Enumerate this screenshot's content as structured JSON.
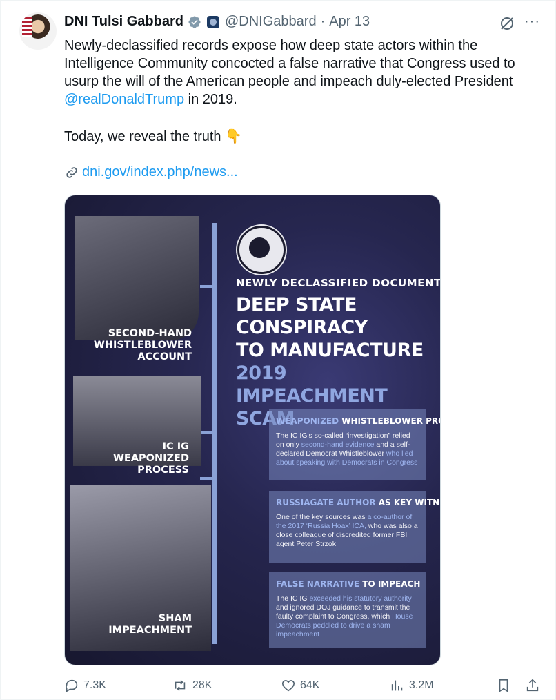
{
  "tweet": {
    "author_name": "DNI Tulsi Gabbard",
    "handle": "@DNIGabbard",
    "separator": "·",
    "date": "Apr 13",
    "more_label": "···",
    "text_before": "Newly-declassified records expose how deep state actors within the Intelligence Community concocted a false narrative that Congress used to usurp the will of the American people and impeach duly-elected President ",
    "mention": "@realDonaldTrump",
    "text_after": " in 2019.",
    "today_line": "Today, we reveal the truth 👇",
    "link_text": "dni.gov/index.php/news..."
  },
  "infographic": {
    "heading_small": "NEWLY DECLASSIFIED DOCUMENTS EXPOSE",
    "heading_line1": "DEEP STATE CONSPIRACY",
    "heading_line2": "TO MANUFACTURE",
    "heading_line3": "2019 IMPEACHMENT",
    "heading_line4": "SCAM",
    "caption1": "SECOND-HAND WHISTLEBLOWER ACCOUNT",
    "caption2": "IC IG WEAPONIZED PROCESS",
    "caption3": "SHAM IMPEACHMENT",
    "box1_title_hl": "WEAPONIZED",
    "box1_title": " WHISTLEBLOWER PROCESS",
    "box1_a": "The IC IG's so-called “investigation” relied on only ",
    "box1_b": "second-hand evidence",
    "box1_c": " and a self-declared Democrat Whistleblower ",
    "box1_d": "who lied about speaking with Democrats in Congress",
    "box2_title_hl": "RUSSIAGATE AUTHOR",
    "box2_title": " AS KEY WITNESS",
    "box2_a": "One of the key sources was ",
    "box2_b": "a co-author of the 2017 ‘Russia Hoax’ ICA,",
    "box2_c": " who was also a close colleague of discredited former FBI agent Peter Strzok",
    "box3_title_hl": "FALSE NARRATIVE",
    "box3_title": " TO IMPEACH",
    "box3_a": "The IC IG ",
    "box3_b": "exceeded his statutory authority",
    "box3_c": " and ignored DOJ guidance to transmit the faulty complaint to Congress, which ",
    "box3_d": "House Democrats peddled to drive a sham impeachment"
  },
  "actions": {
    "replies": "7.3K",
    "reposts": "28K",
    "likes": "64K",
    "views": "3.2M"
  },
  "colors": {
    "accent": "#1d9bf0",
    "muted": "#536471"
  }
}
